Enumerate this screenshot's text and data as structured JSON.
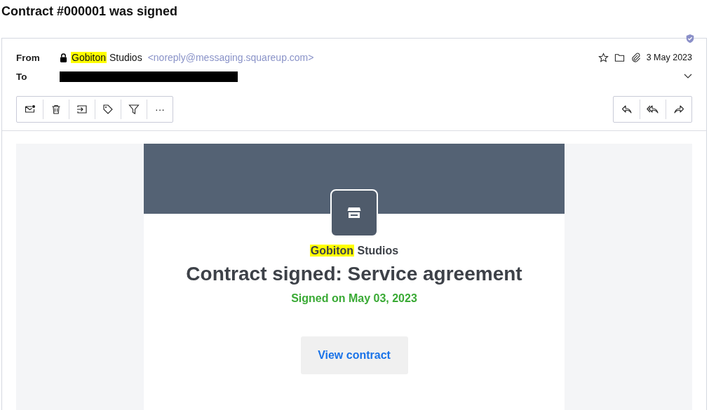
{
  "subject": "Contract #000001 was signed",
  "header": {
    "from_label": "From",
    "sender_name": [
      {
        "text": "Gobiton",
        "highlighted": true
      },
      {
        "text": "Studios",
        "highlighted": false
      }
    ],
    "sender_email": "<noreply@messaging.squareup.com>",
    "to_label": "To",
    "to_redacted": true,
    "date": "3 May 2023"
  },
  "toolbar": [
    {
      "kind": "unread"
    },
    {
      "kind": "delete"
    },
    {
      "kind": "move"
    },
    {
      "kind": "tag"
    },
    {
      "kind": "filter"
    },
    {
      "kind": "more"
    }
  ],
  "more_label": "···",
  "reply_actions": [
    {
      "kind": "reply"
    },
    {
      "kind": "replyall"
    },
    {
      "kind": "forward"
    }
  ],
  "body": {
    "business_name": [
      {
        "text": "Gobiton",
        "highlighted": true
      },
      {
        "text": "Studios",
        "highlighted": false
      }
    ],
    "heading": "Contract signed: Service agreement",
    "signed_note": "Signed on May 03, 2023",
    "button": "View contract"
  }
}
